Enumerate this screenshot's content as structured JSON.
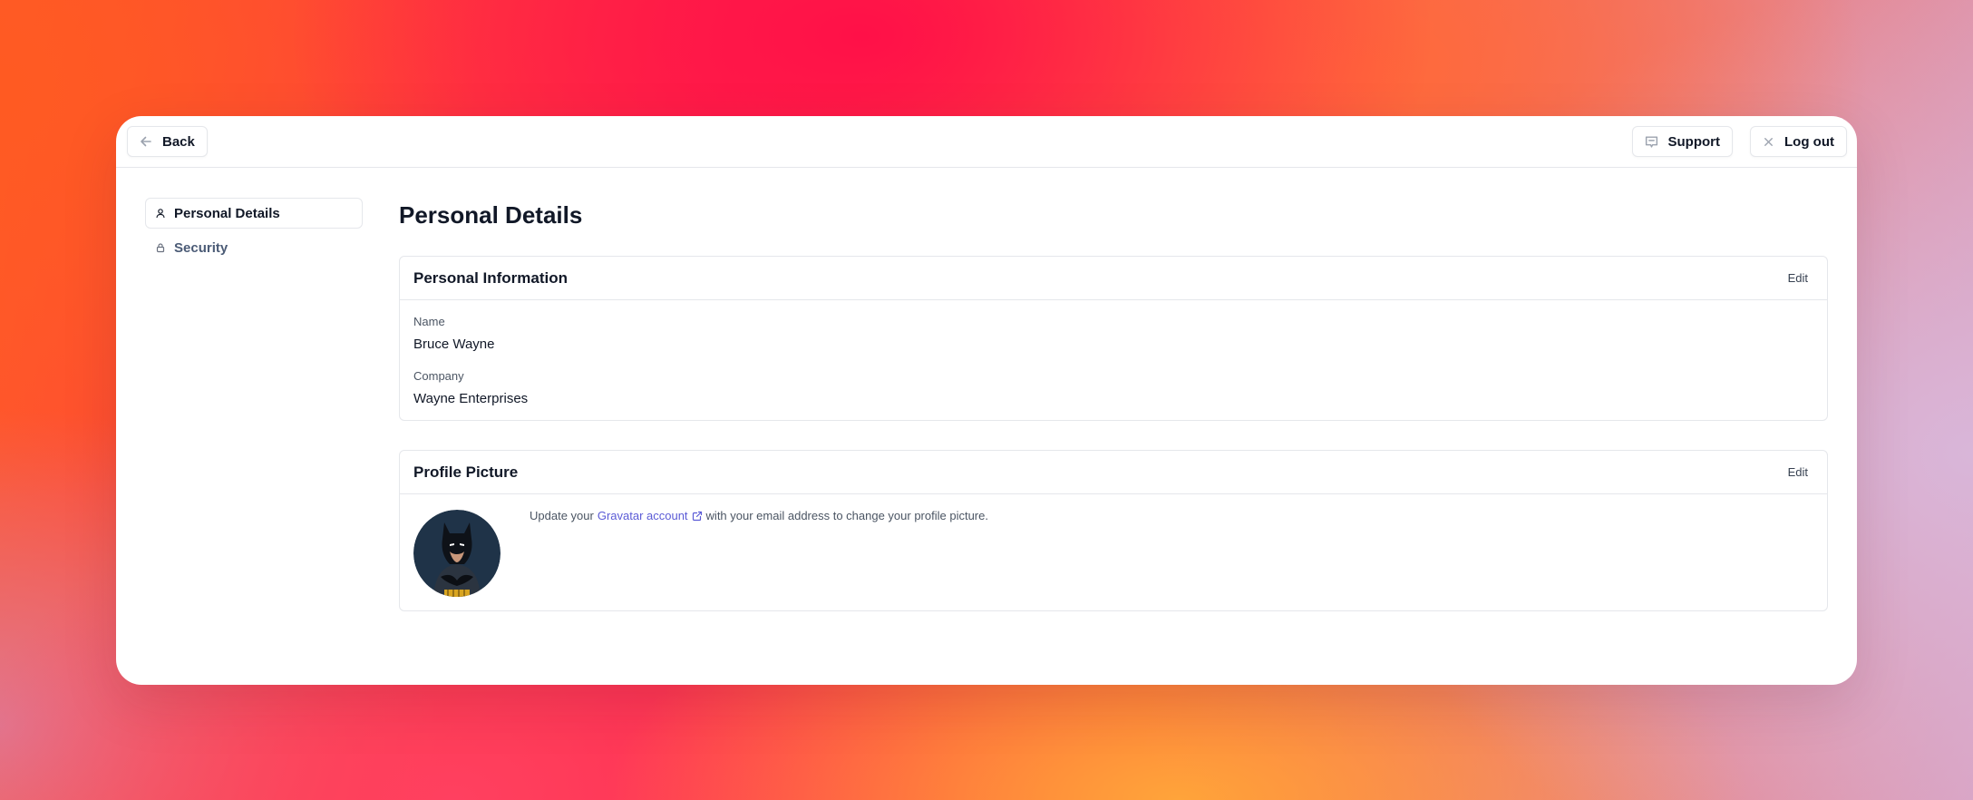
{
  "topbar": {
    "back_label": "Back",
    "support_label": "Support",
    "logout_label": "Log out"
  },
  "sidebar": {
    "items": [
      {
        "label": "Personal Details",
        "icon": "user-icon",
        "active": true
      },
      {
        "label": "Security",
        "icon": "lock-icon",
        "active": false
      }
    ]
  },
  "main": {
    "title": "Personal Details",
    "personal_info": {
      "title": "Personal Information",
      "edit_label": "Edit",
      "fields": [
        {
          "label": "Name",
          "value": "Bruce Wayne"
        },
        {
          "label": "Company",
          "value": "Wayne Enterprises"
        }
      ]
    },
    "profile_picture": {
      "title": "Profile Picture",
      "edit_label": "Edit",
      "text_before": "Update your",
      "link_label": "Gravatar account",
      "text_after": "with your email address to change your profile picture.",
      "avatar_icon": "batman-avatar"
    }
  },
  "colors": {
    "link": "#5b5bd6",
    "border": "#e5e7eb",
    "inactive_nav": "#4b5b76"
  }
}
